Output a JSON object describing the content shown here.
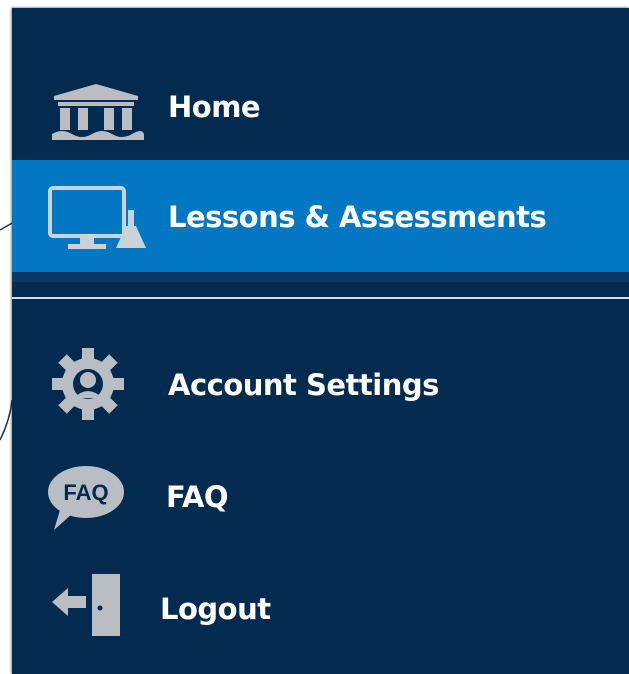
{
  "nav": {
    "items": [
      {
        "id": "home",
        "label": "Home",
        "icon": "museum-building-icon",
        "active": false
      },
      {
        "id": "lessons",
        "label": "Lessons & Assessments",
        "icon": "computer-flask-icon",
        "active": true
      },
      {
        "id": "account",
        "label": "Account Settings",
        "icon": "gear-user-icon",
        "active": false
      },
      {
        "id": "faq",
        "label": "FAQ",
        "icon": "faq-speech-bubble-icon",
        "active": false,
        "icon_text": "FAQ"
      },
      {
        "id": "logout",
        "label": "Logout",
        "icon": "exit-door-arrow-icon",
        "active": false
      }
    ]
  },
  "colors": {
    "sidebar_bg": "#032a4f",
    "active_bg": "#0377c2",
    "icon_gray": "#b9bec4",
    "text": "#ffffff",
    "divider": "#d9dee4"
  }
}
